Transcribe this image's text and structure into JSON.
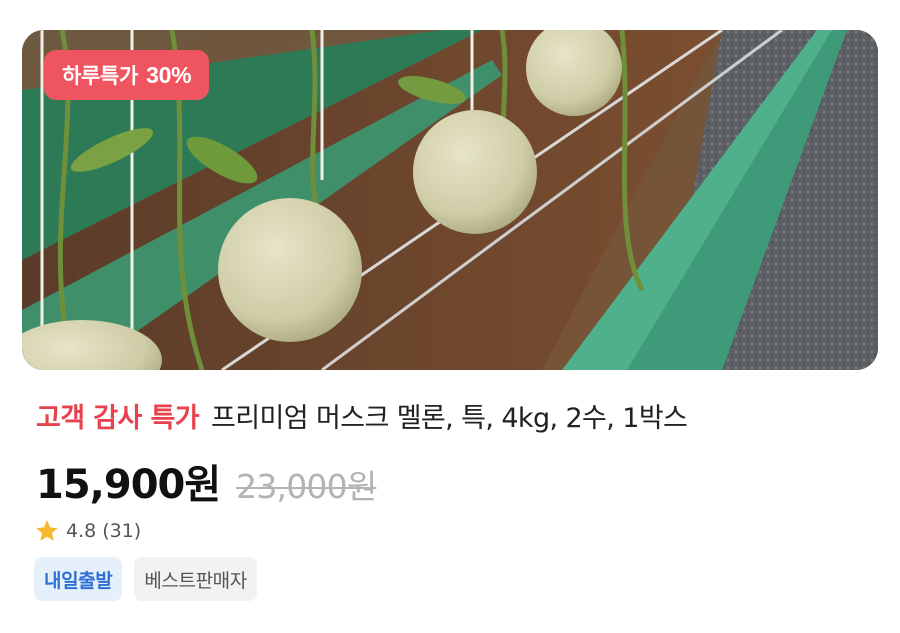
{
  "badge": {
    "text": "하루특가",
    "percent": "30%"
  },
  "product": {
    "promo_label": "고객 감사 특가",
    "name": "프리미엄 머스크 멜론, 특, 4kg, 2수, 1박스",
    "sale_price": "15,900원",
    "original_price": "23,000원"
  },
  "rating": {
    "score": "4.8",
    "count": "(31)"
  },
  "tags": {
    "delivery": "내일출발",
    "seller": "베스트판매자"
  },
  "icons": {
    "wishlist": "heart-icon",
    "rating": "star-icon"
  },
  "colors": {
    "badge_bg": "#ef5560",
    "promo_text": "#e9424f",
    "heart": "#ee4b57",
    "star": "#f5b82e",
    "delivery_tag_text": "#2f6fd6"
  }
}
